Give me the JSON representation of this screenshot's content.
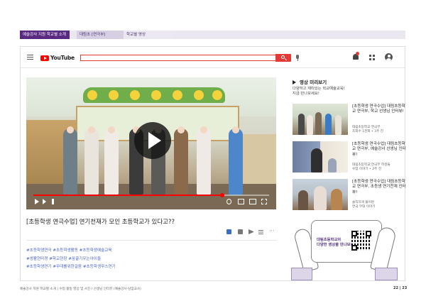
{
  "breadcrumb": {
    "tab1": "예술강사 지원 학교별 소개",
    "tab2": "대림초 [연극부]",
    "tab3": "학교별 영상"
  },
  "youtube": {
    "logo_text": "YouTube",
    "search_placeholder": "",
    "accent_color": "#e53935",
    "icons": [
      "menu-icon",
      "search-icon",
      "mic-icon",
      "bell-icon",
      "apps-icon",
      "account-icon"
    ]
  },
  "video": {
    "title": "[초등학생 연극수업] 연기천재가 모인 초등학교가 있다고??",
    "progress_fraction": 0.8,
    "hashtags": [
      "#초등학생연극 #초등학생활동 #초등학생예술교육",
      "#생활현미경 #학교현장 #꿈꿀기우는아이들",
      "#초등학생연기 #무대를위한걸음 #초등학생무스연기"
    ]
  },
  "preview": {
    "header": "영상 미리보기",
    "desc_line1": "다양하고 재미있는 학교예술교육!",
    "desc_line2": "지금 만나보세요!",
    "cards": [
      {
        "title": "[초등학생 연극수업] 대림초등학교 연극부, 학교 선생님 인터뷰!",
        "meta_line1": "대림초등학교 연극부",
        "meta_line2": "조회수 1천회 • 3주 전"
      },
      {
        "title": "[초등학생 연극수업] 대림초등학교 연극부, 예술강사 선생님 인터뷰!",
        "meta_line1": "대림초등학교 연극부 학생들",
        "meta_line2": "수업 이야기 • 2주 전"
      },
      {
        "title": "[초등학생 연극수업] 대림초등학교 연극부, 초등생 연기천재 인터뷰!",
        "meta_line1": "솔직하게 풀어본",
        "meta_line2": "연극 무대 이야기"
      }
    ]
  },
  "qr": {
    "label_line1": "대림초등학교의",
    "label_line2": "다양한 영상을 만나보세요!"
  },
  "footer": {
    "text": "예술강사 지원 학교별 소개 | 수업 활동 영상 및 사진 / 선생님 인터뷰 (예술강사·담임교사)",
    "page": "22 | 23"
  }
}
